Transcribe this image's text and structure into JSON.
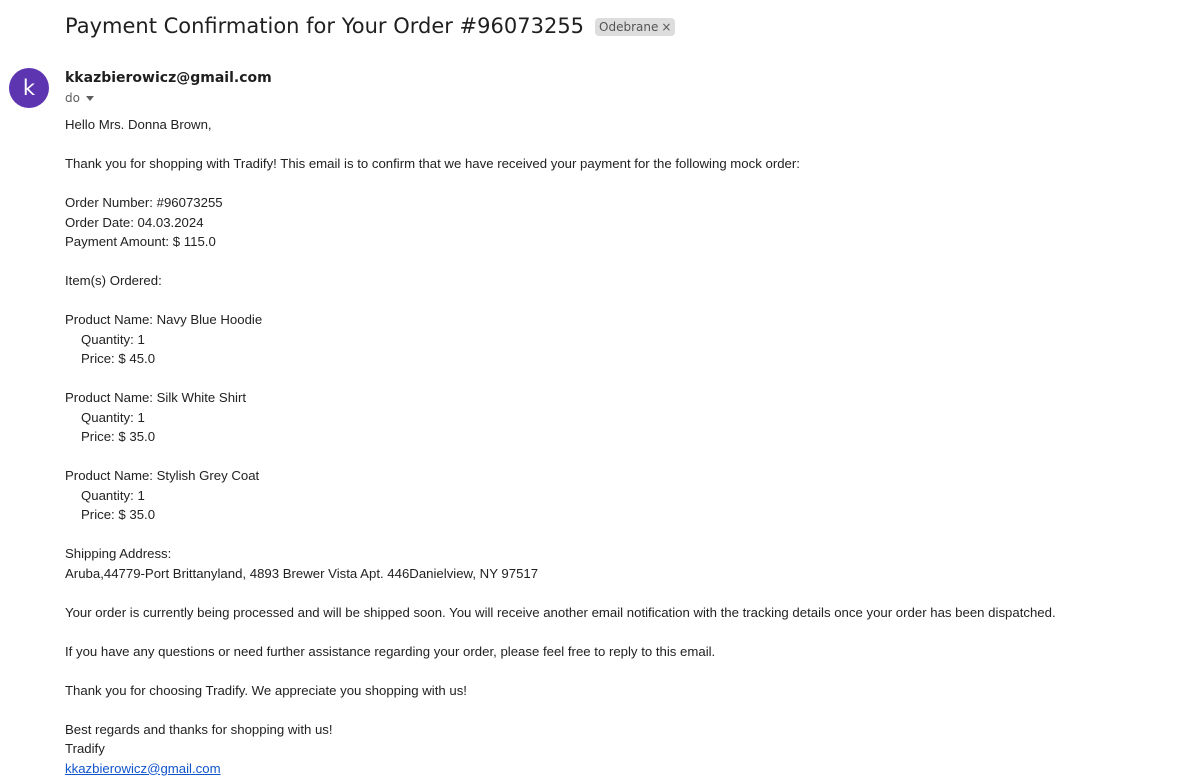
{
  "email": {
    "subject": "Payment Confirmation for Your Order #96073255",
    "label": "Odebrane",
    "label_close": "×",
    "avatar_letter": "k",
    "avatar_color": "#5e35b1",
    "sender": "kkazbierowicz@gmail.com",
    "recipients_label": "do"
  },
  "body": {
    "greeting": "Hello Mrs. Donna Brown,",
    "intro": "Thank you for shopping with Tradify! This email is to confirm that we have received your payment for the following mock order:",
    "order_number": "Order Number: #96073255",
    "order_date": "Order Date: 04.03.2024",
    "payment_amount": "Payment Amount: $ 115.0",
    "items_heading": "Item(s) Ordered:",
    "items": [
      {
        "name": "Product Name: Navy Blue Hoodie",
        "quantity": "Quantity: 1",
        "price": "Price: $ 45.0"
      },
      {
        "name": "Product Name: Silk White Shirt",
        "quantity": "Quantity: 1",
        "price": "Price: $ 35.0"
      },
      {
        "name": "Product Name: Stylish Grey Coat",
        "quantity": "Quantity: 1",
        "price": "Price: $ 35.0"
      }
    ],
    "shipping_heading": "Shipping Address:",
    "shipping_address": "Aruba,44779-Port Brittanyland, 4893 Brewer Vista Apt. 446Danielview, NY 97517",
    "processing_note": "Your order is currently being processed and will be shipped soon. You will receive another email notification with the tracking details once your order has been dispatched.",
    "questions_note": "If you have any questions or need further assistance regarding your order, please feel free to reply to this email.",
    "thanks_note": "Thank you for choosing Tradify. We appreciate you shopping with us!",
    "signoff": "Best regards and thanks for shopping with us!",
    "signature_name": "Tradify",
    "signature_email": "kkazbierowicz@gmail.com"
  },
  "colors": {
    "link": "#1155cc",
    "chip_bg": "#dddddd"
  }
}
